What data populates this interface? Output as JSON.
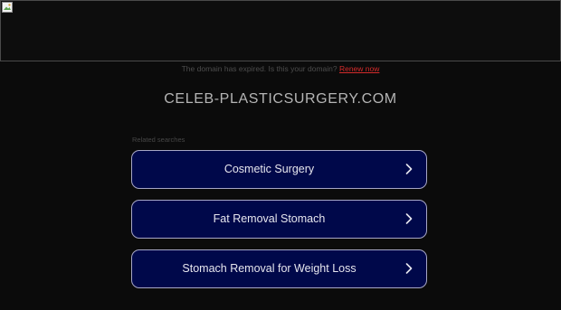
{
  "notice": {
    "text": "The domain has expired. Is this your domain?",
    "renew_label": "Renew now"
  },
  "domain": "CELEB-PLASTICSURGERY.COM",
  "related": {
    "label": "Related searches",
    "items": [
      {
        "label": "Cosmetic Surgery"
      },
      {
        "label": "Fat Removal Stomach"
      },
      {
        "label": "Stomach Removal for Weight Loss"
      }
    ]
  },
  "colors": {
    "background": "#0b0b0b",
    "link_bg": "#00084a",
    "link_border": "#a6a6c6",
    "renew": "#d42b2b"
  },
  "icons": [
    "broken-image-icon",
    "chevron-right-icon"
  ]
}
